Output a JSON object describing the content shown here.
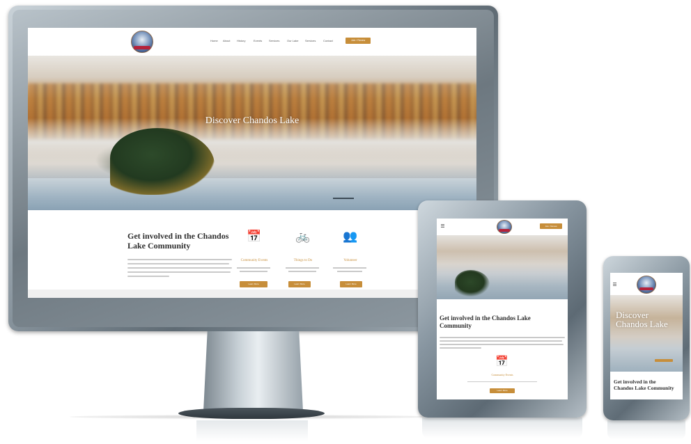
{
  "desktop": {
    "nav": {
      "links": [
        "Home",
        "About",
        "History",
        "Events",
        "Services",
        "Our Lake",
        "Services",
        "Contact"
      ],
      "cta": "Join / Renew"
    },
    "hero": {
      "title": "Discover Chandos Lake"
    },
    "section": {
      "heading": "Get involved in the Chandos Lake Community",
      "cards": [
        {
          "icon": "calendar-icon",
          "glyph": "📅",
          "title": "Community Events",
          "button": "Learn More"
        },
        {
          "icon": "bicycle-icon",
          "glyph": "🚲",
          "title": "Things to Do",
          "button": "Learn More"
        },
        {
          "icon": "people-icon",
          "glyph": "👥",
          "title": "Volunteer",
          "button": "Learn More"
        }
      ]
    }
  },
  "tablet": {
    "cta": "Join / Renew",
    "heading": "Get involved in the Chandos Lake Community",
    "card_title": "Community Events",
    "card_button": "Learn More"
  },
  "phone": {
    "hero_title": "Discover Chandos Lake",
    "heading": "Get involved in the Chandos Lake Community"
  },
  "colors": {
    "accent": "#c78e3a",
    "heading": "#2e2e2e",
    "device_frame": "#8e9aa3"
  }
}
